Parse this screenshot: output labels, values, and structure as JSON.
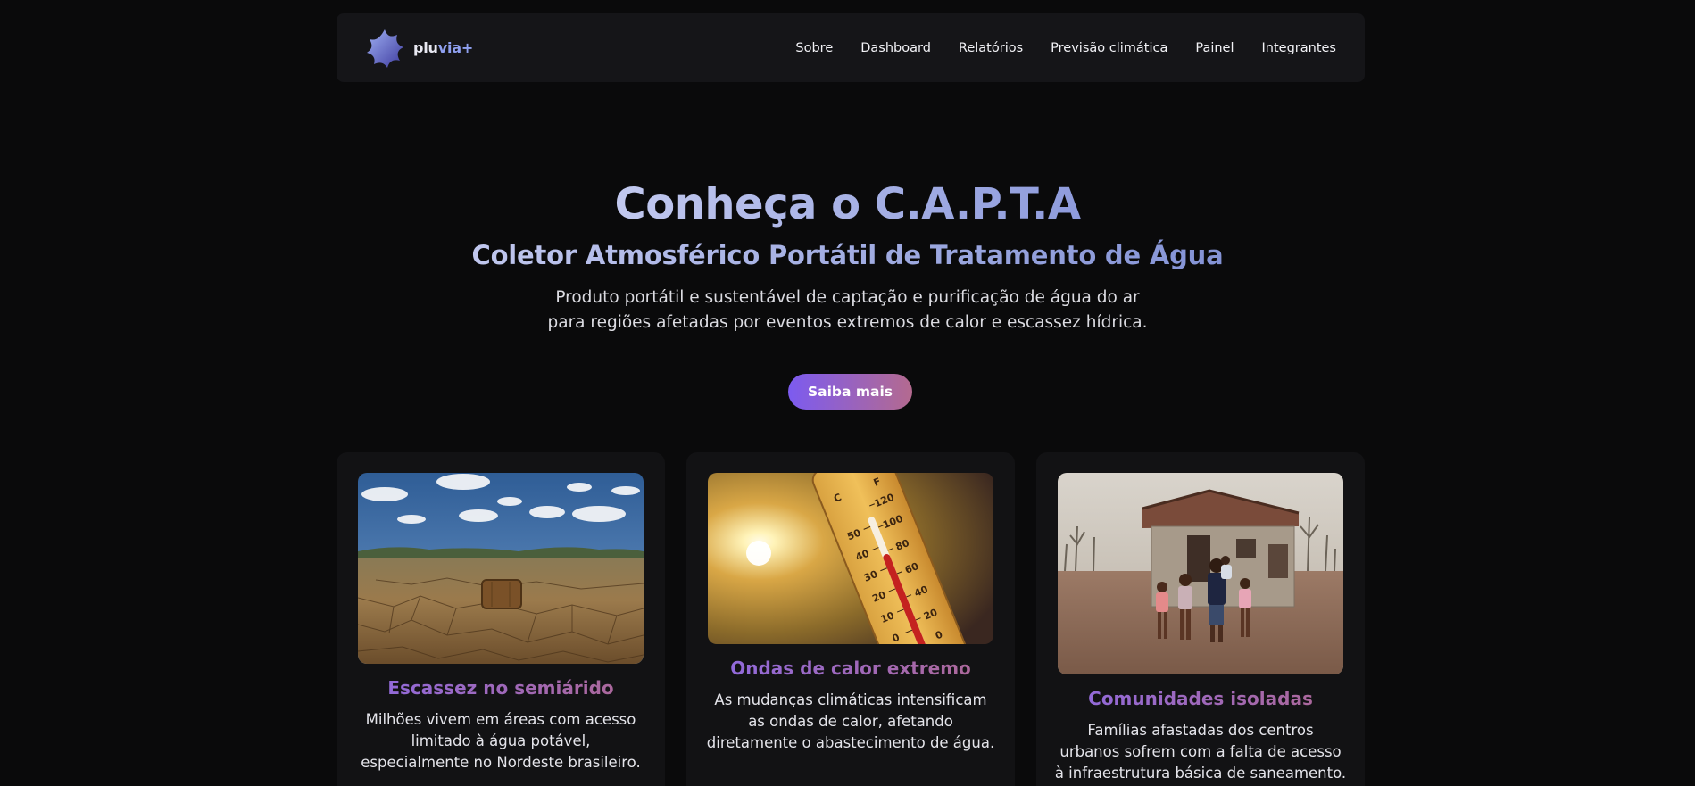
{
  "brand": {
    "name_prefix": "plu",
    "name_accent": "via+",
    "logo_icon": "blob-star-logo-icon"
  },
  "nav": {
    "items": [
      {
        "label": "Sobre"
      },
      {
        "label": "Dashboard"
      },
      {
        "label": "Relatórios"
      },
      {
        "label": "Previsão climática"
      },
      {
        "label": "Painel"
      },
      {
        "label": "Integrantes"
      }
    ]
  },
  "hero": {
    "title": "Conheça o C.A.P.T.A",
    "subtitle": "Coletor Atmosférico Portátil de Tratamento de Água",
    "description_lines": [
      "Produto portátil e sustentável de captação e purificação de água do ar",
      "para regiões afetadas por eventos extremos de calor e escassez hídrica."
    ],
    "cta_label": "Saiba mais"
  },
  "cards": [
    {
      "title": "Escassez no semiárido",
      "text_lines": [
        "Milhões vivem em áreas com acesso",
        "limitado à água potável,",
        "especialmente no Nordeste brasileiro."
      ],
      "image": "drought-cracked-earth-photo"
    },
    {
      "title": "Ondas de calor extremo",
      "text_lines": [
        "As mudanças climáticas intensificam",
        "as ondas de calor, afetando",
        "diretamente o abastecimento de água."
      ],
      "image": "thermometer-sun-photo",
      "thermometer": {
        "scale_c": "C",
        "scale_f": "F",
        "celsius_ticks": [
          "50",
          "40",
          "30",
          "20",
          "10",
          "0"
        ],
        "fahrenheit_ticks": [
          "120",
          "100",
          "80",
          "60",
          "40",
          "20",
          "0"
        ]
      }
    },
    {
      "title": "Comunidades isoladas",
      "text_lines": [
        "Famílias afastadas dos centros",
        "urbanos sofrem com a falta de acesso",
        "à infraestrutura básica de saneamento."
      ],
      "image": "rural-family-house-photo"
    }
  ],
  "colors": {
    "background": "#0a0a0b",
    "navbar": "#151518",
    "card": "#121214",
    "accent_blue": "#8fa0f0",
    "gradient_purple": "#7c5bf0",
    "gradient_rose": "#b46a8f"
  }
}
